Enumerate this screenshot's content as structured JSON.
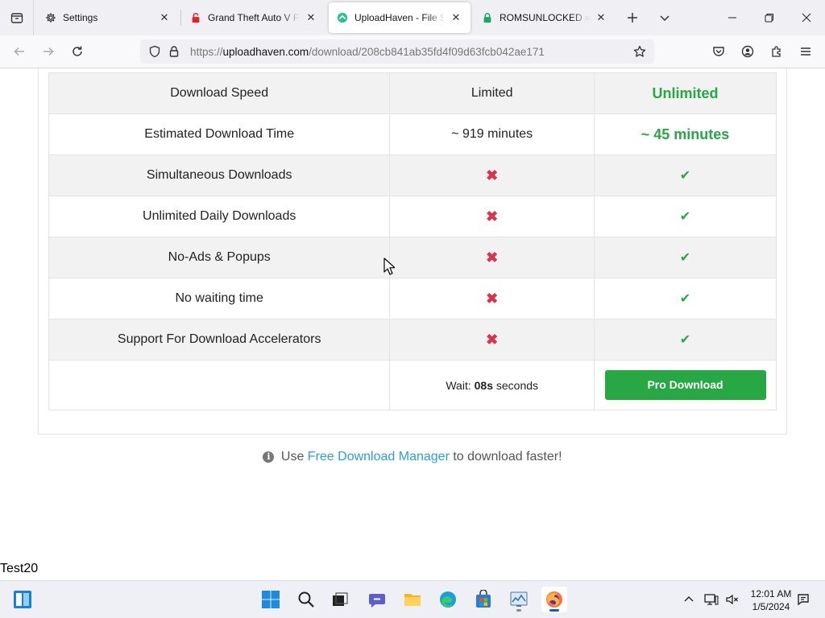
{
  "browser": {
    "tabs": [
      {
        "title": "Settings",
        "active": false,
        "icon": "gear-icon"
      },
      {
        "title": "Grand Theft Auto V Free Download",
        "active": false,
        "icon": "red-lock-icon"
      },
      {
        "title": "UploadHaven - File Sharing",
        "active": true,
        "icon": "uploadhaven-icon"
      },
      {
        "title": "ROMSUNLOCKED » Free",
        "active": false,
        "icon": "green-lock-icon"
      }
    ],
    "url": {
      "scheme": "https://",
      "host": "uploadhaven.com",
      "path": "/download/208cb841ab35fd4f09d63fcb042ae171"
    }
  },
  "page": {
    "comparison": {
      "rows": [
        {
          "feature": "Download Speed",
          "free": "Limited",
          "pro": "Unlimited"
        },
        {
          "feature": "Estimated Download Time",
          "free": "~ 919 minutes",
          "pro": "~ 45 minutes"
        },
        {
          "feature": "Simultaneous Downloads",
          "free": "✖",
          "pro": "✔"
        },
        {
          "feature": "Unlimited Daily Downloads",
          "free": "✖",
          "pro": "✔"
        },
        {
          "feature": "No-Ads & Popups",
          "free": "✖",
          "pro": "✔"
        },
        {
          "feature": "No waiting time",
          "free": "✖",
          "pro": "✔"
        },
        {
          "feature": "Support For Download Accelerators",
          "free": "✖",
          "pro": "✔"
        }
      ],
      "wait_prefix": "Wait:",
      "wait_value": "08s",
      "wait_suffix": "seconds",
      "pro_button": "Pro Download"
    },
    "fdm_notice": {
      "prefix": "Use",
      "link": "Free Download Manager",
      "suffix": "to download faster!"
    },
    "footer_text": "Test20"
  },
  "taskbar": {
    "time": "12:01 AM",
    "date": "1/5/2024"
  },
  "colors": {
    "pro_green": "#28a745",
    "free_red": "#d9344a",
    "link_blue": "#2a9fd6"
  }
}
